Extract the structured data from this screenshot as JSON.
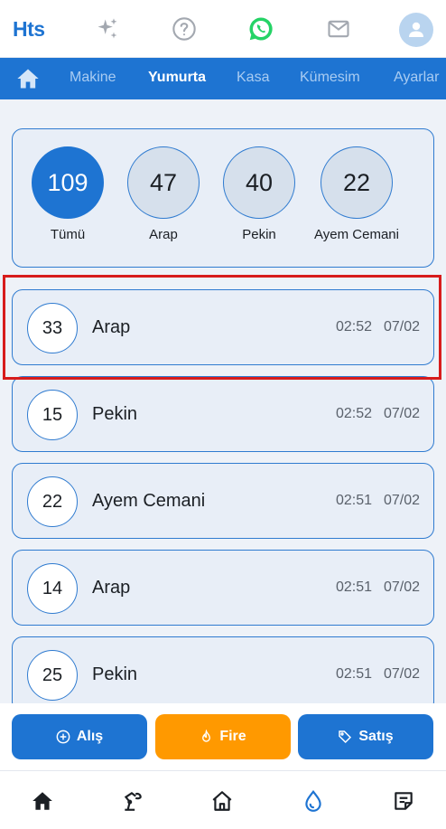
{
  "app": {
    "logo": "Hts"
  },
  "top_icons": [
    "sparkles-icon",
    "help-icon",
    "whatsapp-icon",
    "mail-icon",
    "avatar-icon"
  ],
  "nav": {
    "tabs": [
      {
        "label": "Makine",
        "active": false
      },
      {
        "label": "Yumurta",
        "active": true
      },
      {
        "label": "Kasa",
        "active": false
      },
      {
        "label": "Kümesim",
        "active": false
      },
      {
        "label": "Ayarlar",
        "active": false
      }
    ]
  },
  "summary": [
    {
      "count": "109",
      "label": "Tümü",
      "active": true
    },
    {
      "count": "47",
      "label": "Arap",
      "active": false
    },
    {
      "count": "40",
      "label": "Pekin",
      "active": false
    },
    {
      "count": "22",
      "label": "Ayem Cemani",
      "active": false
    }
  ],
  "entries": [
    {
      "count": "33",
      "name": "Arap",
      "time": "02:52",
      "date": "07/02"
    },
    {
      "count": "15",
      "name": "Pekin",
      "time": "02:52",
      "date": "07/02"
    },
    {
      "count": "22",
      "name": "Ayem Cemani",
      "time": "02:51",
      "date": "07/02"
    },
    {
      "count": "14",
      "name": "Arap",
      "time": "02:51",
      "date": "07/02"
    },
    {
      "count": "25",
      "name": "Pekin",
      "time": "02:51",
      "date": "07/02"
    }
  ],
  "actions": {
    "buy": "Alış",
    "waste": "Fire",
    "sell": "Satış"
  },
  "colors": {
    "primary": "#1e74d2",
    "accent": "#ff9900",
    "whatsapp": "#25d366",
    "highlight": "#d71c1c"
  },
  "bottom_nav": [
    "home-icon",
    "machine-icon",
    "coop-icon",
    "egg-drop-icon",
    "notes-icon"
  ]
}
